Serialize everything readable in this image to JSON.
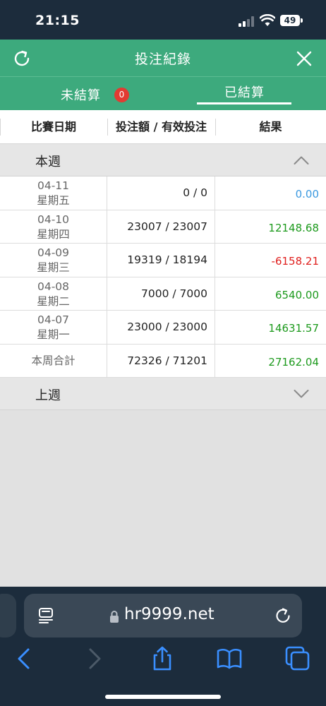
{
  "status": {
    "time": "21:15",
    "battery": "49"
  },
  "header": {
    "title": "投注紀錄"
  },
  "tabs": {
    "unsettled_label": "未結算",
    "unsettled_count": "0",
    "settled_label": "已結算"
  },
  "columns": [
    "比賽日期",
    "投注額 / 有效投注",
    "結果"
  ],
  "this_week": {
    "label": "本週",
    "expanded": true
  },
  "rows": [
    {
      "date": "04-11",
      "weekday": "星期五",
      "stake": "0 / 0",
      "result": "0.00",
      "result_color": "#3b99e0"
    },
    {
      "date": "04-10",
      "weekday": "星期四",
      "stake": "23007 / 23007",
      "result": "12148.68",
      "result_color": "#1d9a1d"
    },
    {
      "date": "04-09",
      "weekday": "星期三",
      "stake": "19319 / 18194",
      "result": "-6158.21",
      "result_color": "#e0201e"
    },
    {
      "date": "04-08",
      "weekday": "星期二",
      "stake": "7000 / 7000",
      "result": "6540.00",
      "result_color": "#1d9a1d"
    },
    {
      "date": "04-07",
      "weekday": "星期一",
      "stake": "23000 / 23000",
      "result": "14631.57",
      "result_color": "#1d9a1d"
    }
  ],
  "total": {
    "label": "本周合計",
    "stake": "72326 / 71201",
    "result": "27162.04",
    "result_color": "#1d9a1d"
  },
  "last_week": {
    "label": "上週",
    "expanded": false
  },
  "browser": {
    "url": "hr9999.net"
  },
  "colors": {
    "brand_green": "#3daa7d",
    "dark_bar": "#1c2c3c",
    "ios_blue": "#3a8fff"
  }
}
